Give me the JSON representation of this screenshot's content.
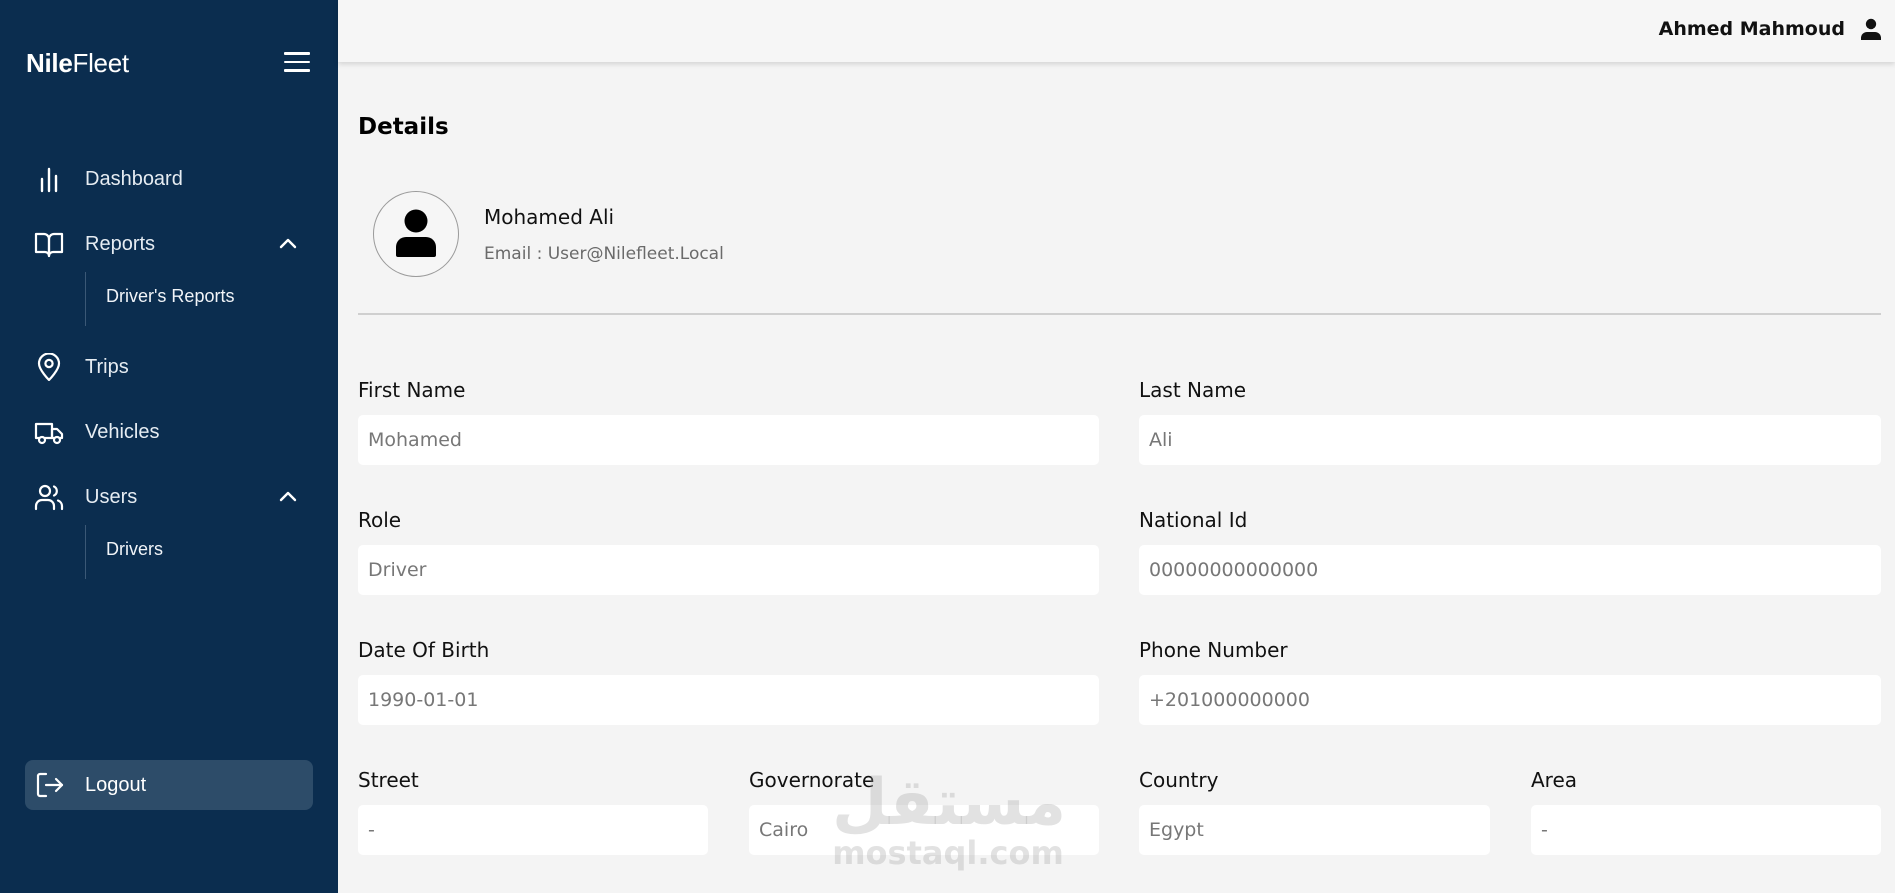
{
  "brand": {
    "part1": "Nile",
    "part2": "Fleet"
  },
  "sidebar": {
    "items": [
      {
        "label": "Dashboard",
        "icon": "bar-chart-icon"
      },
      {
        "label": "Reports",
        "icon": "book-open-icon",
        "expanded": true,
        "children": [
          {
            "label": "Driver's Reports"
          }
        ]
      },
      {
        "label": "Trips",
        "icon": "map-pin-icon"
      },
      {
        "label": "Vehicles",
        "icon": "truck-icon"
      },
      {
        "label": "Users",
        "icon": "users-icon",
        "expanded": true,
        "children": [
          {
            "label": "Drivers"
          }
        ]
      }
    ],
    "logout_label": "Logout"
  },
  "header": {
    "username": "Ahmed Mahmoud"
  },
  "main": {
    "title": "Details",
    "profile": {
      "name": "Mohamed Ali",
      "email": "Email : User@Nilefleet.Local"
    },
    "fields": {
      "first_name": {
        "label": "First Name",
        "value": "Mohamed"
      },
      "last_name": {
        "label": "Last Name",
        "value": "Ali"
      },
      "role": {
        "label": "Role",
        "value": "Driver"
      },
      "national_id": {
        "label": "National Id",
        "value": "00000000000000"
      },
      "dob": {
        "label": "Date Of Birth",
        "value": "1990-01-01"
      },
      "phone": {
        "label": "Phone Number",
        "value": "+201000000000"
      },
      "street": {
        "label": "Street",
        "value": "-"
      },
      "governorate": {
        "label": "Governorate",
        "value": "Cairo"
      },
      "country": {
        "label": "Country",
        "value": "Egypt"
      },
      "area": {
        "label": "Area",
        "value": "-"
      }
    }
  },
  "watermark": {
    "arabic": "مستقل",
    "latin": "mostaql.com"
  },
  "colors": {
    "sidebar_bg": "#0b2d4f",
    "logout_bg": "#2d4c69",
    "page_bg": "#f4f4f4"
  }
}
